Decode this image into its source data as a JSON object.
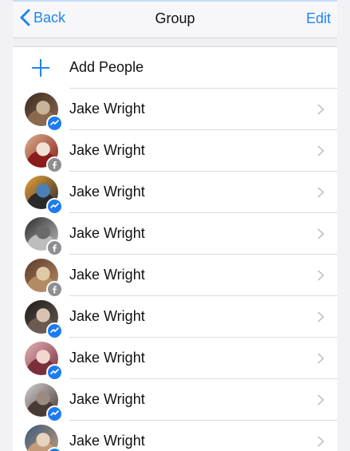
{
  "navbar": {
    "back_label": "Back",
    "title": "Group",
    "edit_label": "Edit"
  },
  "add_people": {
    "label": "Add People"
  },
  "members": [
    {
      "name": "Jake Wright",
      "badge": "messenger"
    },
    {
      "name": "Jake Wright",
      "badge": "facebook"
    },
    {
      "name": "Jake Wright",
      "badge": "messenger"
    },
    {
      "name": "Jake Wright",
      "badge": "facebook"
    },
    {
      "name": "Jake Wright",
      "badge": "facebook"
    },
    {
      "name": "Jake Wright",
      "badge": "messenger"
    },
    {
      "name": "Jake Wright",
      "badge": "messenger"
    },
    {
      "name": "Jake Wright",
      "badge": "messenger"
    },
    {
      "name": "Jake Wright",
      "badge": "messenger"
    }
  ],
  "colors": {
    "accent": "#1e85f0",
    "messenger_badge": "#1d7cf2",
    "facebook_badge": "#8e8e93"
  }
}
